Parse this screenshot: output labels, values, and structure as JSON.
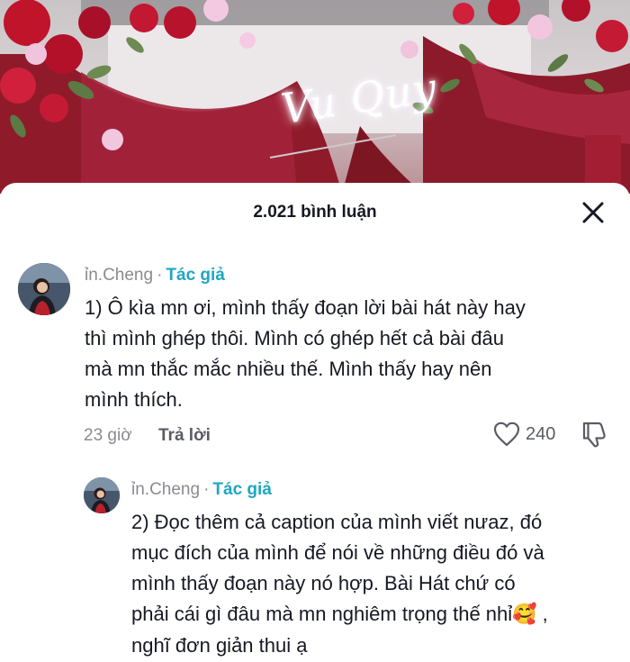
{
  "video": {
    "sign_text": "Vu Quy"
  },
  "sheet": {
    "comment_count_label": "2.021 bình luận",
    "close_icon": "close-icon"
  },
  "comments": [
    {
      "username": "ỉn.Cheng",
      "separator": "·",
      "author_tag": "Tác giả",
      "lines": [
        "1) Ô kìa mn ơi, mình thấy đoạn lời bài hát này hay",
        "thì mình ghép thôi. Mình có ghép hết cả bài đâu",
        "mà mn thắc mắc nhiều thế. Mình thấy hay nên",
        "mình thích."
      ],
      "time": "23 giờ",
      "reply_label": "Trả lời",
      "like_count": "240"
    },
    {
      "username": "ỉn.Cheng",
      "separator": "·",
      "author_tag": "Tác giả",
      "lines": [
        "2) Đọc thêm cả caption của mình viết nưaz, đó",
        "mục đích của mình để nói về những điều đó và",
        "mình thấy đoạn này nó hợp. Bài Hát chứ có",
        "phải cái gì đâu mà mn nghiêm trọng thế nhỉ",
        "nghĩ đơn giản thui ạ"
      ],
      "emoji": "🥰",
      "line4_suffix": " ,"
    }
  ]
}
